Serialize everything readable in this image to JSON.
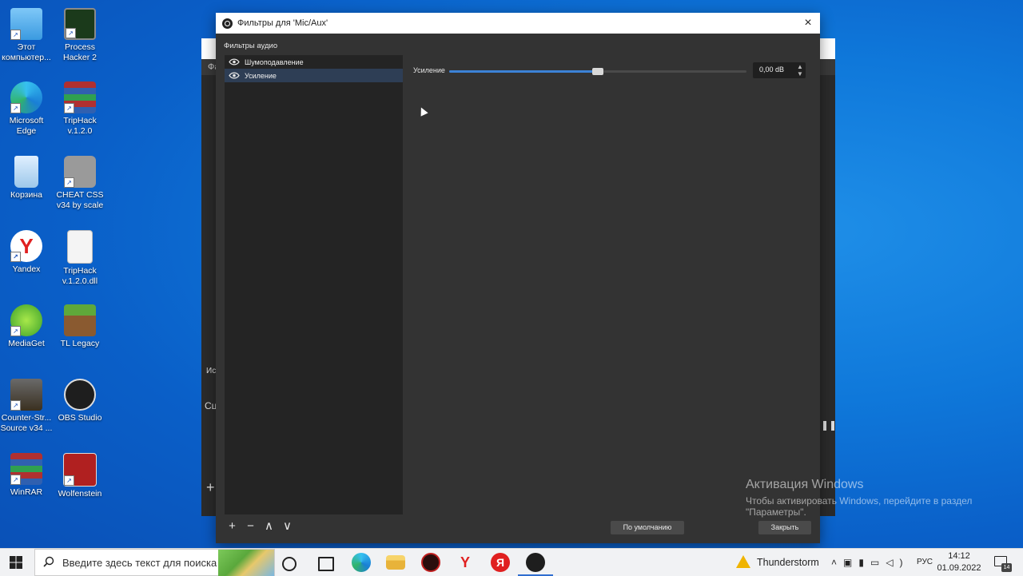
{
  "desktop": {
    "icons": [
      {
        "label": "Этот компьютер..."
      },
      {
        "label": "Process Hacker 2"
      },
      {
        "label": "Microsoft Edge"
      },
      {
        "label": "TripHack v.1.2.0"
      },
      {
        "label": "Корзина"
      },
      {
        "label": "CHEAT CSS v34 by scale"
      },
      {
        "label": "Yandex"
      },
      {
        "label": "TripHack v.1.2.0.dll"
      },
      {
        "label": "MediaGet"
      },
      {
        "label": "TL Legacy"
      },
      {
        "label": "Counter-Str... Source v34 ..."
      },
      {
        "label": "OBS Studio"
      },
      {
        "label": "WinRAR"
      },
      {
        "label": "Wolfenstein"
      }
    ]
  },
  "main_window": {
    "menu_first": "Фа",
    "label_sources": "Ист",
    "label_scenes": "Сц"
  },
  "dialog": {
    "title": "Фильтры для 'Mic/Aux'",
    "close_icon": "×",
    "section_label": "Фильтры аудио",
    "filters": [
      {
        "name": "Шумоподавление",
        "selected": false
      },
      {
        "name": "Усиление",
        "selected": true
      }
    ],
    "property": {
      "label": "Усиление",
      "value_text": "0,00 dB",
      "slider_fraction": 0.5
    },
    "toolbar": {
      "add": "+",
      "remove": "−",
      "up": "∧",
      "down": "∨"
    },
    "defaults_button": "По умолчанию",
    "close_button": "Закрыть"
  },
  "activation": {
    "line1": "Активация Windows",
    "line2": "Чтобы активировать Windows, перейдите в раздел",
    "line3": "\"Параметры\"."
  },
  "taskbar": {
    "search_placeholder": "Введите здесь текст для поиска",
    "weather": "Thunderstorm",
    "language": "РУС",
    "time": "14:12",
    "date": "01.09.2022",
    "notifications_count": "14"
  },
  "colors": {
    "accent": "#3c82d6",
    "dialog_bg": "#333333",
    "list_bg": "#242424",
    "selected_row": "#2e3e55"
  }
}
